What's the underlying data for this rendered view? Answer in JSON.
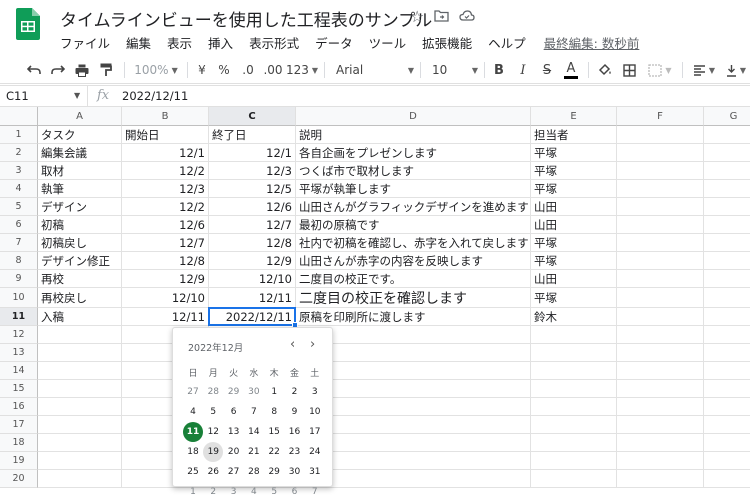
{
  "app": {
    "document_title": "タイムラインビューを使用した工程表のサンプル",
    "last_edit": "最終編集: 数秒前",
    "menu": [
      "ファイル",
      "編集",
      "表示",
      "挿入",
      "表示形式",
      "データ",
      "ツール",
      "拡張機能",
      "ヘルプ"
    ]
  },
  "toolbar": {
    "zoom": "100%",
    "currency": "¥",
    "percent": "%",
    "decimal_decrease": ".0",
    "decimal_increase": ".00",
    "number_format": "123",
    "font": "Arial",
    "font_size": "10",
    "bold": "B",
    "italic": "I",
    "strike": "S",
    "text_color": "A"
  },
  "formula_bar": {
    "cell_ref": "C11",
    "fx": "fx",
    "value": "2022/12/11"
  },
  "grid": {
    "columns": [
      "A",
      "B",
      "C",
      "D",
      "E",
      "F",
      "G"
    ],
    "selected_column": "C",
    "selected_row": 11,
    "rows": [
      [
        "タスク",
        "開始日",
        "終了日",
        "説明",
        "担当者"
      ],
      [
        "編集会議",
        "12/1",
        "12/1",
        "各自企画をプレゼンします",
        "平塚"
      ],
      [
        "取材",
        "12/2",
        "12/3",
        "つくば市で取材します",
        "平塚"
      ],
      [
        "執筆",
        "12/3",
        "12/5",
        "平塚が執筆します",
        "平塚"
      ],
      [
        "デザイン",
        "12/2",
        "12/6",
        "山田さんがグラフィックデザインを進めます",
        "山田"
      ],
      [
        "初稿",
        "12/6",
        "12/7",
        "最初の原稿です",
        "山田"
      ],
      [
        "初稿戻し",
        "12/7",
        "12/8",
        "社内で初稿を確認し、赤字を入れて戻します",
        "平塚"
      ],
      [
        "デザイン修正",
        "12/8",
        "12/9",
        "山田さんが赤字の内容を反映します",
        "平塚"
      ],
      [
        "再校",
        "12/9",
        "12/10",
        "二度目の校正です。",
        "山田"
      ],
      [
        "再校戻し",
        "12/10",
        "12/11",
        "二度目の校正を確認します",
        "平塚"
      ],
      [
        "入稿",
        "12/11",
        "2022/12/11",
        "原稿を印刷所に渡します",
        "鈴木"
      ]
    ],
    "row_numbers": [
      "1",
      "2",
      "3",
      "4",
      "5",
      "6",
      "7",
      "8",
      "9",
      "10",
      "11",
      "12",
      "13",
      "14",
      "15",
      "16",
      "17",
      "18",
      "19",
      "20"
    ]
  },
  "date_picker": {
    "month_label": "2022年12月",
    "weekdays": [
      "日",
      "月",
      "火",
      "水",
      "木",
      "金",
      "土"
    ],
    "weeks": [
      [
        "27",
        "28",
        "29",
        "30",
        "1",
        "2",
        "3"
      ],
      [
        "4",
        "5",
        "6",
        "7",
        "8",
        "9",
        "10"
      ],
      [
        "11",
        "12",
        "13",
        "14",
        "15",
        "16",
        "17"
      ],
      [
        "18",
        "19",
        "20",
        "21",
        "22",
        "23",
        "24"
      ],
      [
        "25",
        "26",
        "27",
        "28",
        "29",
        "30",
        "31"
      ],
      [
        "1",
        "2",
        "3",
        "4",
        "5",
        "6",
        "7"
      ]
    ],
    "selected_day": "11",
    "today_day": "19",
    "selected_color": "#188038"
  },
  "colors": {
    "accent": "#1a73e8",
    "sheets_green": "#0f9d58"
  }
}
